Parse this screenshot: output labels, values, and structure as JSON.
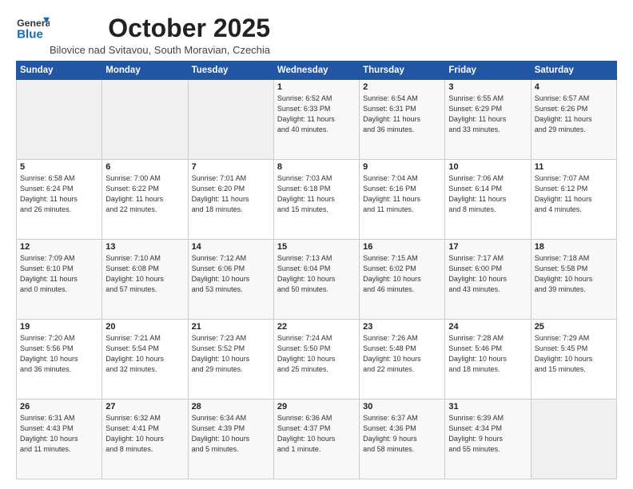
{
  "header": {
    "logo_general": "General",
    "logo_blue": "Blue",
    "month_title": "October 2025",
    "subtitle": "Bilovice nad Svitavou, South Moravian, Czechia"
  },
  "weekdays": [
    "Sunday",
    "Monday",
    "Tuesday",
    "Wednesday",
    "Thursday",
    "Friday",
    "Saturday"
  ],
  "weeks": [
    [
      {
        "day": "",
        "info": ""
      },
      {
        "day": "",
        "info": ""
      },
      {
        "day": "",
        "info": ""
      },
      {
        "day": "1",
        "info": "Sunrise: 6:52 AM\nSunset: 6:33 PM\nDaylight: 11 hours\nand 40 minutes."
      },
      {
        "day": "2",
        "info": "Sunrise: 6:54 AM\nSunset: 6:31 PM\nDaylight: 11 hours\nand 36 minutes."
      },
      {
        "day": "3",
        "info": "Sunrise: 6:55 AM\nSunset: 6:29 PM\nDaylight: 11 hours\nand 33 minutes."
      },
      {
        "day": "4",
        "info": "Sunrise: 6:57 AM\nSunset: 6:26 PM\nDaylight: 11 hours\nand 29 minutes."
      }
    ],
    [
      {
        "day": "5",
        "info": "Sunrise: 6:58 AM\nSunset: 6:24 PM\nDaylight: 11 hours\nand 26 minutes."
      },
      {
        "day": "6",
        "info": "Sunrise: 7:00 AM\nSunset: 6:22 PM\nDaylight: 11 hours\nand 22 minutes."
      },
      {
        "day": "7",
        "info": "Sunrise: 7:01 AM\nSunset: 6:20 PM\nDaylight: 11 hours\nand 18 minutes."
      },
      {
        "day": "8",
        "info": "Sunrise: 7:03 AM\nSunset: 6:18 PM\nDaylight: 11 hours\nand 15 minutes."
      },
      {
        "day": "9",
        "info": "Sunrise: 7:04 AM\nSunset: 6:16 PM\nDaylight: 11 hours\nand 11 minutes."
      },
      {
        "day": "10",
        "info": "Sunrise: 7:06 AM\nSunset: 6:14 PM\nDaylight: 11 hours\nand 8 minutes."
      },
      {
        "day": "11",
        "info": "Sunrise: 7:07 AM\nSunset: 6:12 PM\nDaylight: 11 hours\nand 4 minutes."
      }
    ],
    [
      {
        "day": "12",
        "info": "Sunrise: 7:09 AM\nSunset: 6:10 PM\nDaylight: 11 hours\nand 0 minutes."
      },
      {
        "day": "13",
        "info": "Sunrise: 7:10 AM\nSunset: 6:08 PM\nDaylight: 10 hours\nand 57 minutes."
      },
      {
        "day": "14",
        "info": "Sunrise: 7:12 AM\nSunset: 6:06 PM\nDaylight: 10 hours\nand 53 minutes."
      },
      {
        "day": "15",
        "info": "Sunrise: 7:13 AM\nSunset: 6:04 PM\nDaylight: 10 hours\nand 50 minutes."
      },
      {
        "day": "16",
        "info": "Sunrise: 7:15 AM\nSunset: 6:02 PM\nDaylight: 10 hours\nand 46 minutes."
      },
      {
        "day": "17",
        "info": "Sunrise: 7:17 AM\nSunset: 6:00 PM\nDaylight: 10 hours\nand 43 minutes."
      },
      {
        "day": "18",
        "info": "Sunrise: 7:18 AM\nSunset: 5:58 PM\nDaylight: 10 hours\nand 39 minutes."
      }
    ],
    [
      {
        "day": "19",
        "info": "Sunrise: 7:20 AM\nSunset: 5:56 PM\nDaylight: 10 hours\nand 36 minutes."
      },
      {
        "day": "20",
        "info": "Sunrise: 7:21 AM\nSunset: 5:54 PM\nDaylight: 10 hours\nand 32 minutes."
      },
      {
        "day": "21",
        "info": "Sunrise: 7:23 AM\nSunset: 5:52 PM\nDaylight: 10 hours\nand 29 minutes."
      },
      {
        "day": "22",
        "info": "Sunrise: 7:24 AM\nSunset: 5:50 PM\nDaylight: 10 hours\nand 25 minutes."
      },
      {
        "day": "23",
        "info": "Sunrise: 7:26 AM\nSunset: 5:48 PM\nDaylight: 10 hours\nand 22 minutes."
      },
      {
        "day": "24",
        "info": "Sunrise: 7:28 AM\nSunset: 5:46 PM\nDaylight: 10 hours\nand 18 minutes."
      },
      {
        "day": "25",
        "info": "Sunrise: 7:29 AM\nSunset: 5:45 PM\nDaylight: 10 hours\nand 15 minutes."
      }
    ],
    [
      {
        "day": "26",
        "info": "Sunrise: 6:31 AM\nSunset: 4:43 PM\nDaylight: 10 hours\nand 11 minutes."
      },
      {
        "day": "27",
        "info": "Sunrise: 6:32 AM\nSunset: 4:41 PM\nDaylight: 10 hours\nand 8 minutes."
      },
      {
        "day": "28",
        "info": "Sunrise: 6:34 AM\nSunset: 4:39 PM\nDaylight: 10 hours\nand 5 minutes."
      },
      {
        "day": "29",
        "info": "Sunrise: 6:36 AM\nSunset: 4:37 PM\nDaylight: 10 hours\nand 1 minute."
      },
      {
        "day": "30",
        "info": "Sunrise: 6:37 AM\nSunset: 4:36 PM\nDaylight: 9 hours\nand 58 minutes."
      },
      {
        "day": "31",
        "info": "Sunrise: 6:39 AM\nSunset: 4:34 PM\nDaylight: 9 hours\nand 55 minutes."
      },
      {
        "day": "",
        "info": ""
      }
    ]
  ]
}
